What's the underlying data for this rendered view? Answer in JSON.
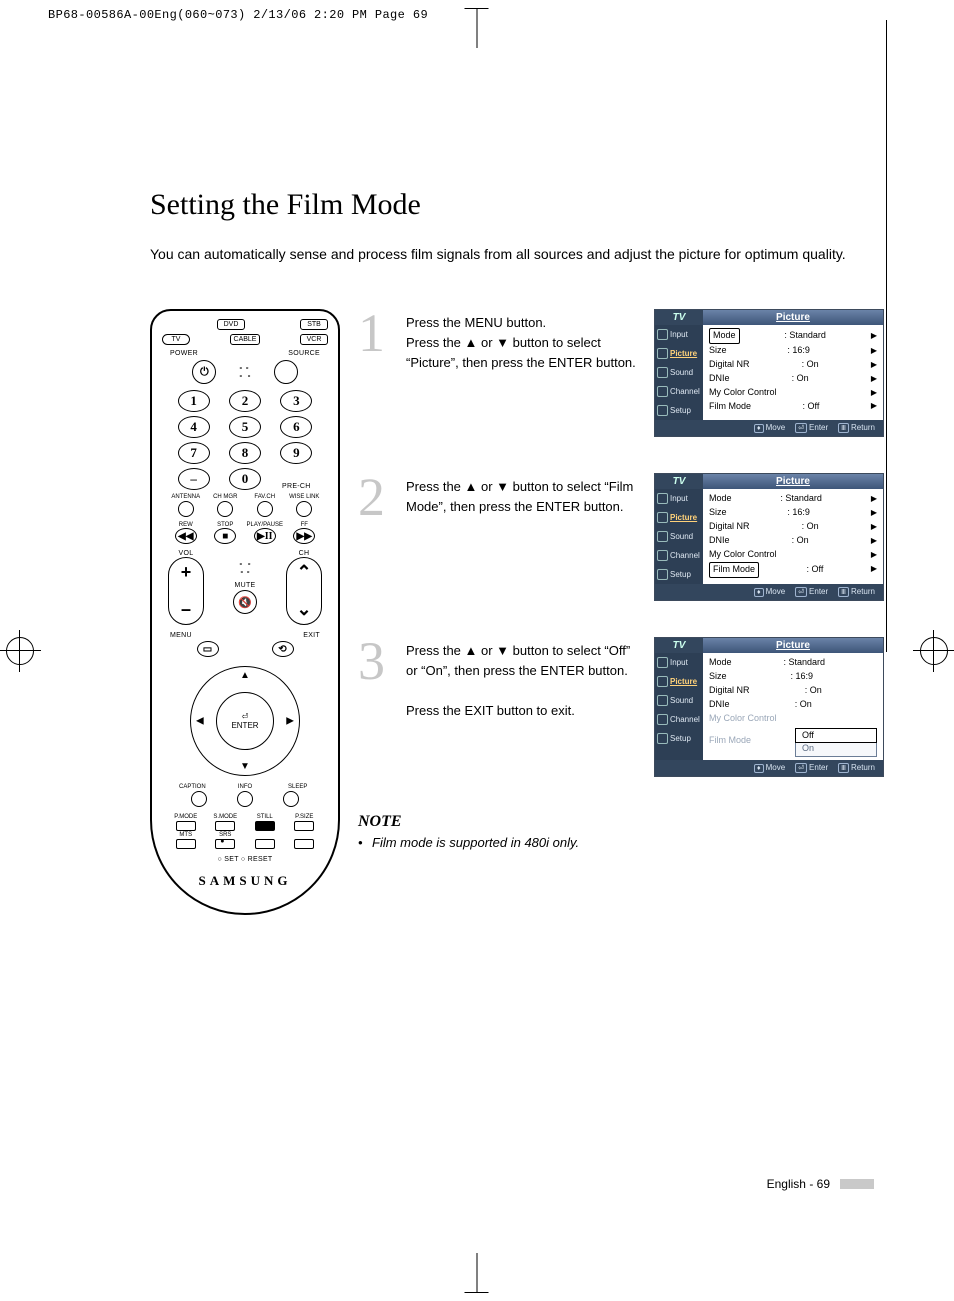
{
  "jobline": "BP68-00586A-00Eng(060~073)  2/13/06  2:20 PM  Page 69",
  "title": "Setting the Film Mode",
  "intro": "You can automatically sense and process film signals from all sources and adjust the picture for optimum quality.",
  "remote": {
    "brand": "SAMSUNG",
    "sources": [
      "TV",
      "DVD",
      "STB",
      "CABLE",
      "VCR"
    ],
    "power": "POWER",
    "source": "SOURCE",
    "keypad": [
      "1",
      "2",
      "3",
      "4",
      "5",
      "6",
      "7",
      "8",
      "9",
      "–",
      "0",
      ""
    ],
    "prech": "PRE-CH",
    "row_labels_1": [
      "ANTENNA",
      "CH MGR",
      "FAV.CH",
      "WISE LINK"
    ],
    "row_labels_2": [
      "REW",
      "STOP",
      "PLAY/PAUSE",
      "FF"
    ],
    "transport": [
      "◀◀",
      "■",
      "▶II",
      "▶▶"
    ],
    "vol": "VOL",
    "ch": "CH",
    "mute": "MUTE",
    "menu": "MENU",
    "exit": "EXIT",
    "enter": "ENTER",
    "row_labels_3": [
      "CAPTION",
      "INFO",
      "SLEEP"
    ],
    "row_labels_4": [
      "P.MODE",
      "S.MODE",
      "STILL",
      "P.SIZE"
    ],
    "row_labels_5": [
      "MTS",
      "SRS",
      "",
      ""
    ],
    "setreset": "○ SET       ○ RESET"
  },
  "steps": [
    {
      "n": "1",
      "text": "Press the MENU button.\nPress the ▲ or ▼ button to select “Picture”, then press the ENTER button."
    },
    {
      "n": "2",
      "text": "Press the ▲ or ▼ button to select “Film Mode”, then press the ENTER button."
    },
    {
      "n": "3",
      "text": "Press the ▲ or ▼ button to select “Off” or “On”, then press the ENTER button.\n\nPress the EXIT button to exit."
    }
  ],
  "osd": {
    "tv": "TV",
    "title": "Picture",
    "nav": [
      "Input",
      "Picture",
      "Sound",
      "Channel",
      "Setup"
    ],
    "rows": [
      {
        "k": "Mode",
        "v": ": Standard"
      },
      {
        "k": "Size",
        "v": ": 16:9"
      },
      {
        "k": "Digital NR",
        "v": ": On"
      },
      {
        "k": "DNIe",
        "v": ": On"
      },
      {
        "k": "My Color Control",
        "v": ""
      },
      {
        "k": "Film Mode",
        "v": ": Off"
      }
    ],
    "opts": [
      "Off",
      "On"
    ],
    "bar": {
      "move": "Move",
      "enter": "Enter",
      "return": "Return"
    }
  },
  "note": {
    "h": "NOTE",
    "item": "Film mode is supported in 480i only."
  },
  "footer": "English - 69"
}
